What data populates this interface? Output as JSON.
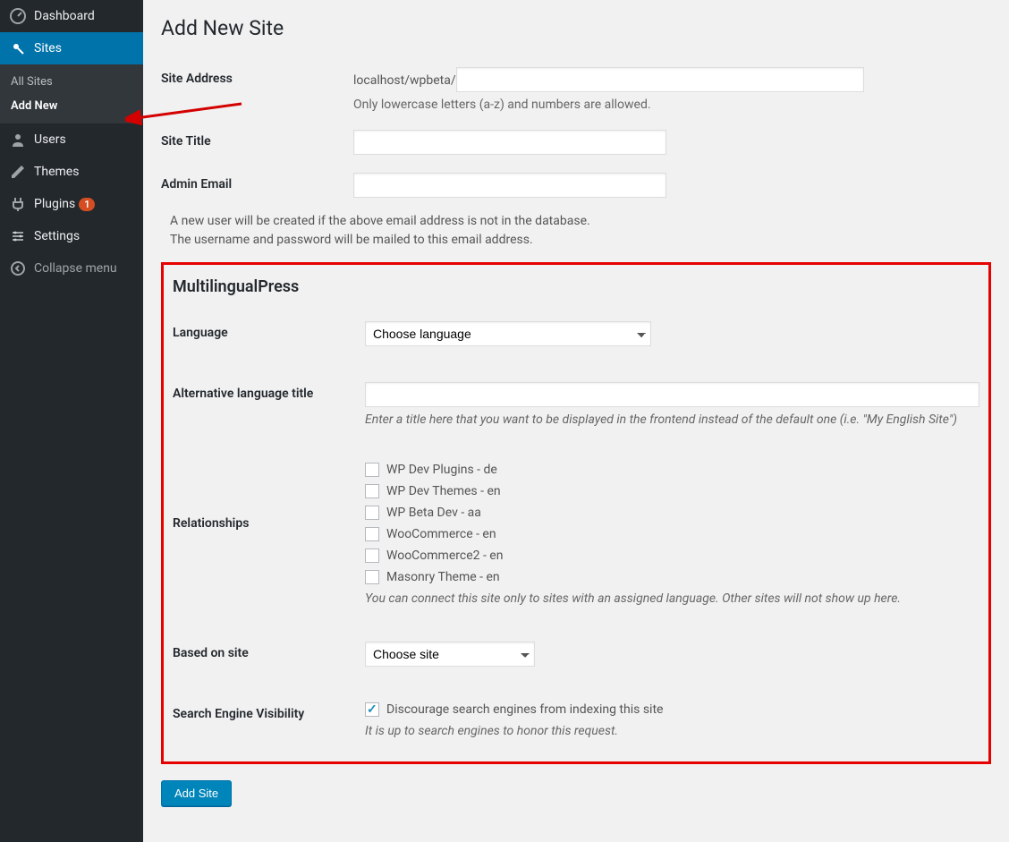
{
  "sidebar": {
    "dashboard": "Dashboard",
    "sites": "Sites",
    "submenu": {
      "all_sites": "All Sites",
      "add_new": "Add New"
    },
    "users": "Users",
    "themes": "Themes",
    "plugins": "Plugins",
    "plugins_badge": "1",
    "settings": "Settings",
    "collapse": "Collapse menu"
  },
  "page": {
    "title": "Add New Site",
    "site_address_label": "Site Address",
    "site_address_prefix": "localhost/wpbeta/",
    "site_address_hint": "Only lowercase letters (a-z) and numbers are allowed.",
    "site_title_label": "Site Title",
    "admin_email_label": "Admin Email",
    "note_line1": "A new user will be created if the above email address is not in the database.",
    "note_line2": "The username and password will be mailed to this email address.",
    "add_button": "Add Site"
  },
  "mlp": {
    "heading": "MultilingualPress",
    "language_label": "Language",
    "language_selected": "Choose language",
    "alt_title_label": "Alternative language title",
    "alt_title_hint": "Enter a title here that you want to be displayed in the frontend instead of the default one (i.e. \"My English Site\")",
    "relationships_label": "Relationships",
    "relationships": [
      "WP Dev Plugins - de",
      "WP Dev Themes - en",
      "WP Beta Dev - aa",
      "WooCommerce - en",
      "WooCommerce2 - en",
      "Masonry Theme - en"
    ],
    "relationships_hint": "You can connect this site only to sites with an assigned language. Other sites will not show up here.",
    "based_on_label": "Based on site",
    "based_on_selected": "Choose site",
    "sev_label": "Search Engine Visibility",
    "sev_checkbox": "Discourage search engines from indexing this site",
    "sev_hint": "It is up to search engines to honor this request."
  }
}
